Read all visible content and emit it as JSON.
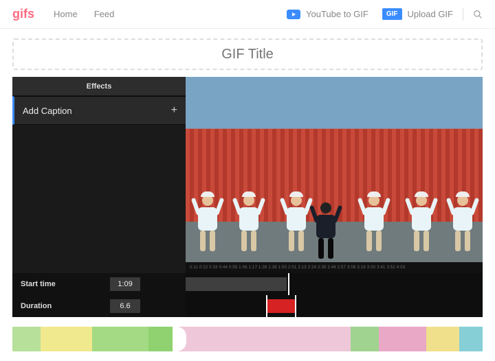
{
  "header": {
    "logo": "gifs",
    "nav": {
      "home": "Home",
      "feed": "Feed"
    },
    "youtube_to_gif": "YouTube to GIF",
    "gif_badge": "GIF",
    "upload_gif": "Upload GIF"
  },
  "title": {
    "placeholder": "GIF Title"
  },
  "sidebar": {
    "effects_tab": "Effects",
    "add_caption": "Add Caption",
    "plus": "+"
  },
  "time": {
    "start_label": "Start time",
    "start_value": "1:09",
    "duration_label": "Duration",
    "duration_value": "6.6"
  },
  "ruler": {
    "ticks": [
      "0:11",
      "0:22",
      "0:33",
      "0:44",
      "0:55",
      "1:06",
      "1:17",
      "1:28",
      "1:39",
      "1:50",
      "2:01",
      "2:13",
      "2:24",
      "2:35",
      "2:46",
      "2:57",
      "3:08",
      "3:19",
      "3:30",
      "3:41",
      "3:52",
      "4:03"
    ]
  },
  "colorstrip": {
    "segments": [
      {
        "color": "#b7e09b",
        "w": 6
      },
      {
        "color": "#f1e98e",
        "w": 11
      },
      {
        "color": "#a4da84",
        "w": 12
      },
      {
        "color": "#8fd26f",
        "w": 5
      },
      {
        "color": "#eec8d9",
        "w": 38
      },
      {
        "color": "#9fd38f",
        "w": 6
      },
      {
        "color": "#e9a8c6",
        "w": 10
      },
      {
        "color": "#f0e08c",
        "w": 7
      },
      {
        "color": "#86cfd6",
        "w": 5
      }
    ]
  }
}
